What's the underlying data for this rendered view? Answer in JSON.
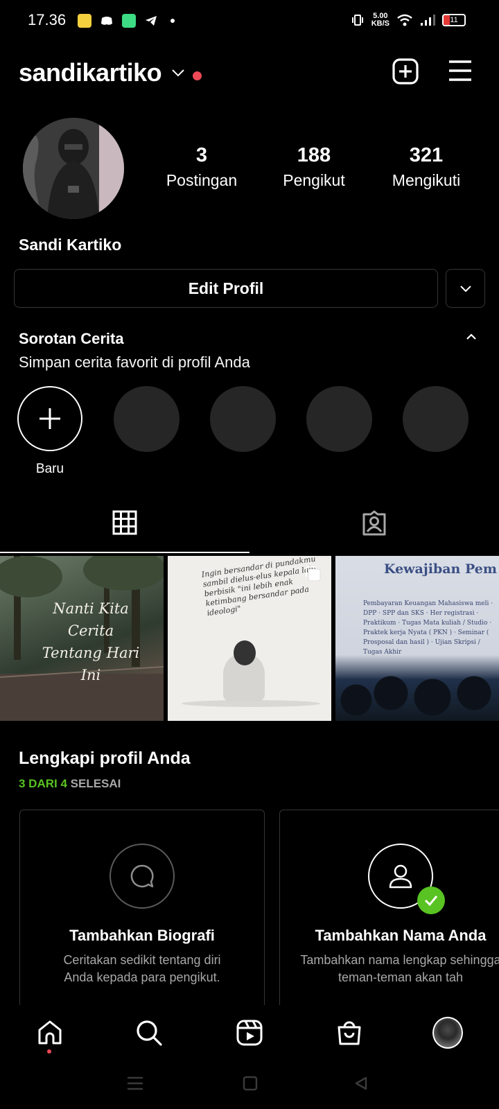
{
  "status_bar": {
    "time": "17.36",
    "net_speed_value": "5.00",
    "net_speed_unit": "KB/S",
    "battery": "11"
  },
  "header": {
    "username": "sandikartiko"
  },
  "profile": {
    "full_name": "Sandi Kartiko",
    "stats": [
      {
        "value": "3",
        "label": "Postingan"
      },
      {
        "value": "188",
        "label": "Pengikut"
      },
      {
        "value": "321",
        "label": "Mengikuti"
      }
    ],
    "edit_label": "Edit Profil"
  },
  "highlights": {
    "title": "Sorotan Cerita",
    "subtitle": "Simpan cerita favorit di profil Anda",
    "new_label": "Baru"
  },
  "posts": {
    "post1_text": "Nanti Kita Cerita Tentang Hari Ini",
    "post2_text": "Ingin bersandar di pundakmu sambil dielus-elus kepala lalu berbisik \"ini lebih enak ketimbang bersandar pada ideologi\"",
    "post3_title": "Kewajiban Pem Keuangan Mah",
    "post3_items": "Pembayaran Keuangan Mahasiswa meli · DPP · SPP dan SKS · Her registrasi · Praktikum · Tugas Mata kuliah / Studio · Praktek kerja Nyata ( PKN ) · Seminar ( Prosposal dan hasil ) · Ujian Skripsi / Tugas Akhir"
  },
  "complete_profile": {
    "title": "Lengkapi profil Anda",
    "progress_done": "3 DARI 4",
    "progress_label": "SELESAI",
    "cards": [
      {
        "title": "Tambahkan Biografi",
        "desc": "Ceritakan sedikit tentang diri Anda kepada para pengikut."
      },
      {
        "title": "Tambahkan Nama Anda",
        "desc": "Tambahkan nama lengkap sehingga teman-teman akan tah"
      }
    ]
  },
  "colors": {
    "background": "#000000",
    "accent_red": "#ed4956",
    "success_green": "#58c322",
    "border": "#363636",
    "highlight_placeholder": "#262626"
  }
}
